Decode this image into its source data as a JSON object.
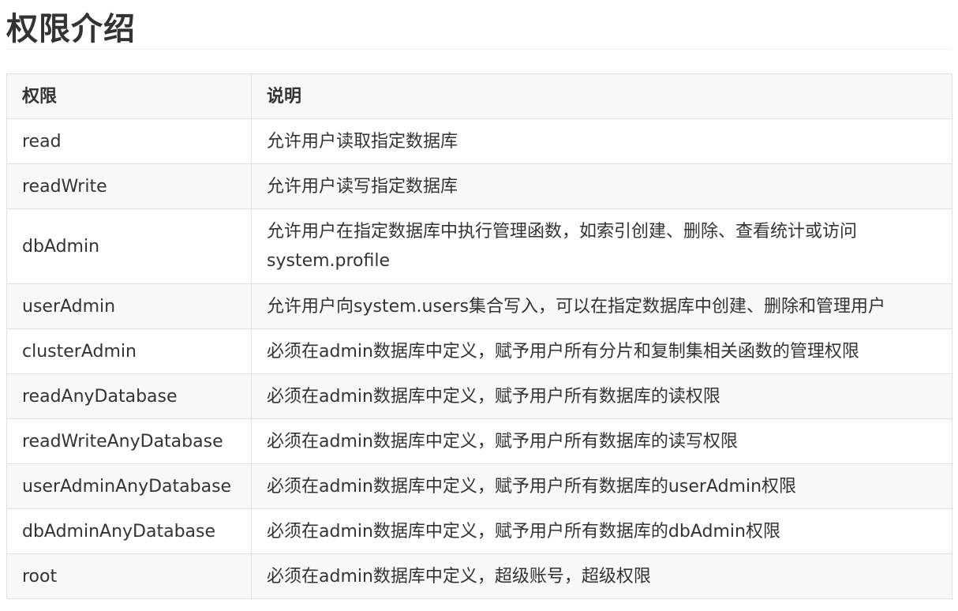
{
  "page": {
    "title": "权限介绍"
  },
  "table": {
    "headers": [
      "权限",
      "说明"
    ],
    "rows": [
      {
        "role": "read",
        "description": "允许用户读取指定数据库"
      },
      {
        "role": "readWrite",
        "description": "允许用户读写指定数据库"
      },
      {
        "role": "dbAdmin",
        "description": "允许用户在指定数据库中执行管理函数，如索引创建、删除、查看统计或访问system.profile"
      },
      {
        "role": "userAdmin",
        "description": "允许用户向system.users集合写入，可以在指定数据库中创建、删除和管理用户"
      },
      {
        "role": "clusterAdmin",
        "description": "必须在admin数据库中定义，赋予用户所有分片和复制集相关函数的管理权限"
      },
      {
        "role": "readAnyDatabase",
        "description": "必须在admin数据库中定义，赋予用户所有数据库的读权限"
      },
      {
        "role": "readWriteAnyDatabase",
        "description": "必须在admin数据库中定义，赋予用户所有数据库的读写权限"
      },
      {
        "role": "userAdminAnyDatabase",
        "description": "必须在admin数据库中定义，赋予用户所有数据库的userAdmin权限"
      },
      {
        "role": "dbAdminAnyDatabase",
        "description": "必须在admin数据库中定义，赋予用户所有数据库的dbAdmin权限"
      },
      {
        "role": "root",
        "description": "必须在admin数据库中定义，超级账号，超级权限"
      }
    ]
  }
}
